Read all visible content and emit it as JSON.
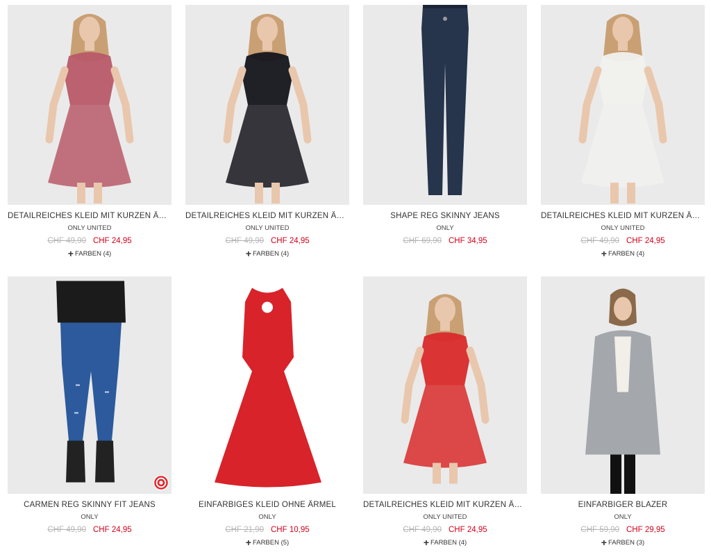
{
  "products": [
    {
      "title": "DETAILREICHES KLEID MIT KURZEN ÄR...",
      "brand": "ONLY UNITED",
      "old_price": "CHF 49,90",
      "sale_price": "CHF 24,95",
      "colors_label": "FARBEN (4)",
      "garment": "dress-lace",
      "color": "#b85a68"
    },
    {
      "title": "DETAILREICHES KLEID MIT KURZEN ÄR...",
      "brand": "ONLY UNITED",
      "old_price": "CHF 49,90",
      "sale_price": "CHF 24,95",
      "colors_label": "FARBEN (4)",
      "garment": "dress-lace",
      "color": "#15151c"
    },
    {
      "title": "SHAPE REG SKINNY JEANS",
      "brand": "ONLY",
      "old_price": "CHF 69,90",
      "sale_price": "CHF 34,95",
      "colors_label": "",
      "garment": "jeans-flat",
      "color": "#26344c"
    },
    {
      "title": "DETAILREICHES KLEID MIT KURZEN ÄR...",
      "brand": "ONLY UNITED",
      "old_price": "CHF 49,90",
      "sale_price": "CHF 24,95",
      "colors_label": "FARBEN (4)",
      "garment": "dress-lace",
      "color": "#f1f1ee"
    },
    {
      "title": "CARMEN REG SKINNY FIT JEANS",
      "brand": "ONLY",
      "old_price": "CHF 49,90",
      "sale_price": "CHF 24,95",
      "colors_label": "",
      "garment": "jeans-worn",
      "color": "#2c5a9c",
      "badge": "target-icon"
    },
    {
      "title": "EINFARBIGES KLEID OHNE ÄRMEL",
      "brand": "ONLY",
      "old_price": "CHF 21,90",
      "sale_price": "CHF 10,95",
      "colors_label": "FARBEN (5)",
      "garment": "dress-flat",
      "color": "#d8232a"
    },
    {
      "title": "DETAILREICHES KLEID MIT KURZEN ÄR...",
      "brand": "ONLY UNITED",
      "old_price": "CHF 49,90",
      "sale_price": "CHF 24,95",
      "colors_label": "FARBEN (4)",
      "garment": "dress-lace",
      "color": "#d92a2a"
    },
    {
      "title": "EINFARBIGER BLAZER",
      "brand": "ONLY",
      "old_price": "CHF 59,90",
      "sale_price": "CHF 29,95",
      "colors_label": "FARBEN (3)",
      "garment": "blazer",
      "color": "#a4a8ad"
    }
  ],
  "colors": {
    "sale": "#d0021b",
    "strike": "#b5b5b5",
    "photo_bg": "#eaeaea",
    "badge": "#e0262b"
  }
}
